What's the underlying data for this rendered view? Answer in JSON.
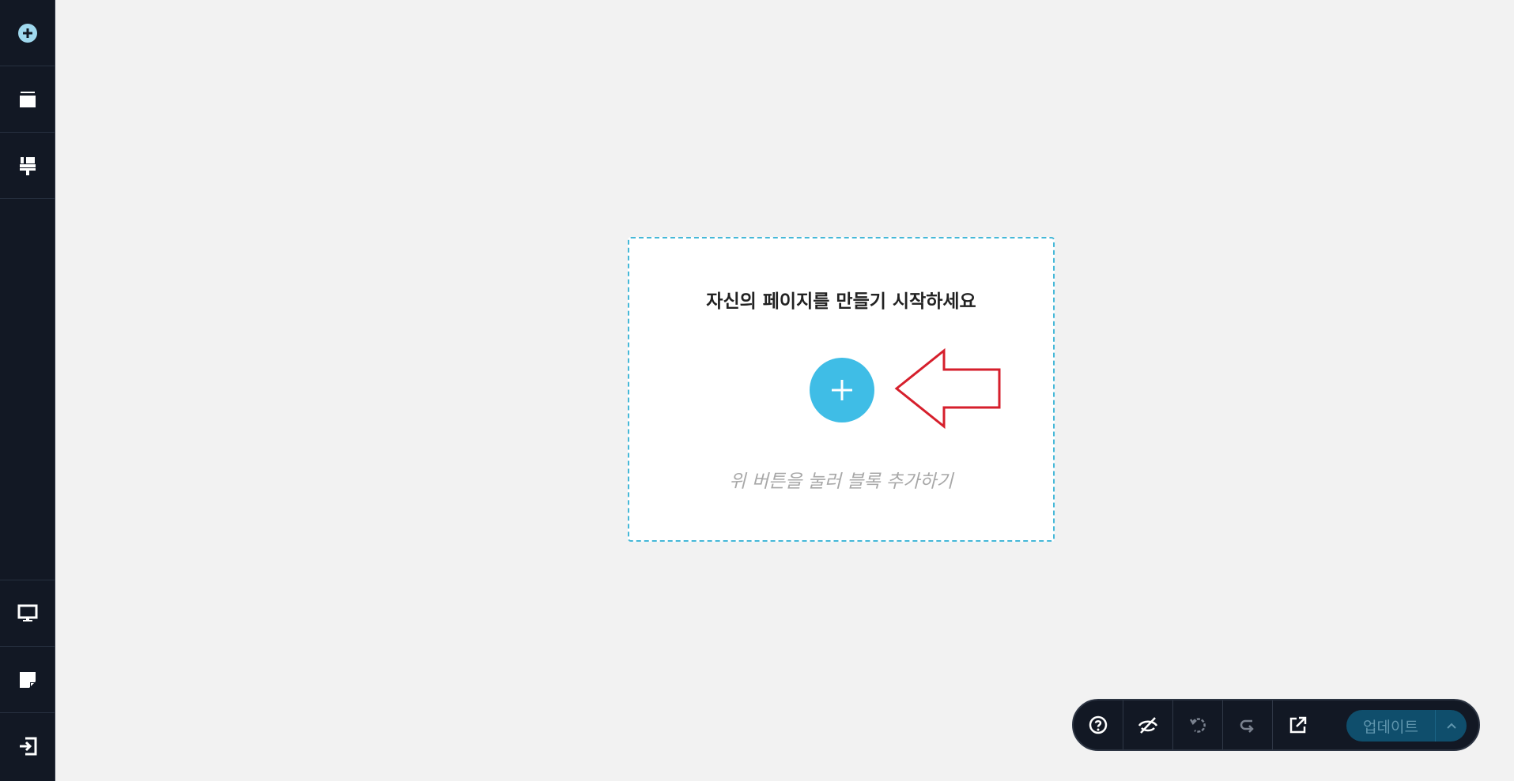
{
  "sidebar": {
    "top_items": [
      {
        "icon": "add-circle-icon"
      },
      {
        "icon": "layers-icon"
      },
      {
        "icon": "paint-brush-icon"
      }
    ],
    "bottom_items": [
      {
        "icon": "desktop-icon"
      },
      {
        "icon": "note-icon"
      },
      {
        "icon": "exit-icon"
      }
    ]
  },
  "dropzone": {
    "heading": "자신의 페이지를 만들기 시작하세요",
    "hint": "위 버튼을 눌러 블록 추가하기",
    "accent_color": "#3fbde6",
    "annotation_arrow_color": "#d61f2c"
  },
  "toolbar": {
    "buttons": [
      {
        "icon": "help-icon"
      },
      {
        "icon": "eye-off-icon"
      },
      {
        "icon": "undo-icon"
      },
      {
        "icon": "redo-icon"
      },
      {
        "icon": "external-link-icon"
      }
    ],
    "update_label": "업데이트",
    "update_color": "#0f4e6c"
  }
}
